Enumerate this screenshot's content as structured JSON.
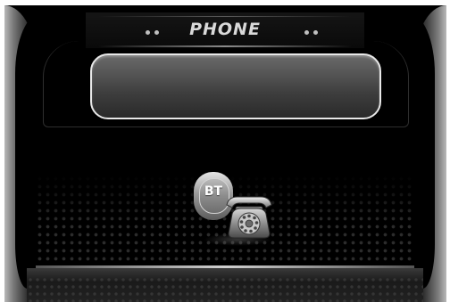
{
  "header": {
    "title": "PHONE"
  },
  "display": {
    "text": ""
  },
  "bluetooth_button": {
    "label": "BT",
    "icon": "bluetooth-phone-icon"
  },
  "telephone": {
    "icon": "rotary-telephone-icon"
  },
  "colors": {
    "background": "#000000",
    "bezel": "#9a9a9a",
    "title_text": "#d9d9d9",
    "field_border": "#e8e8e8"
  }
}
